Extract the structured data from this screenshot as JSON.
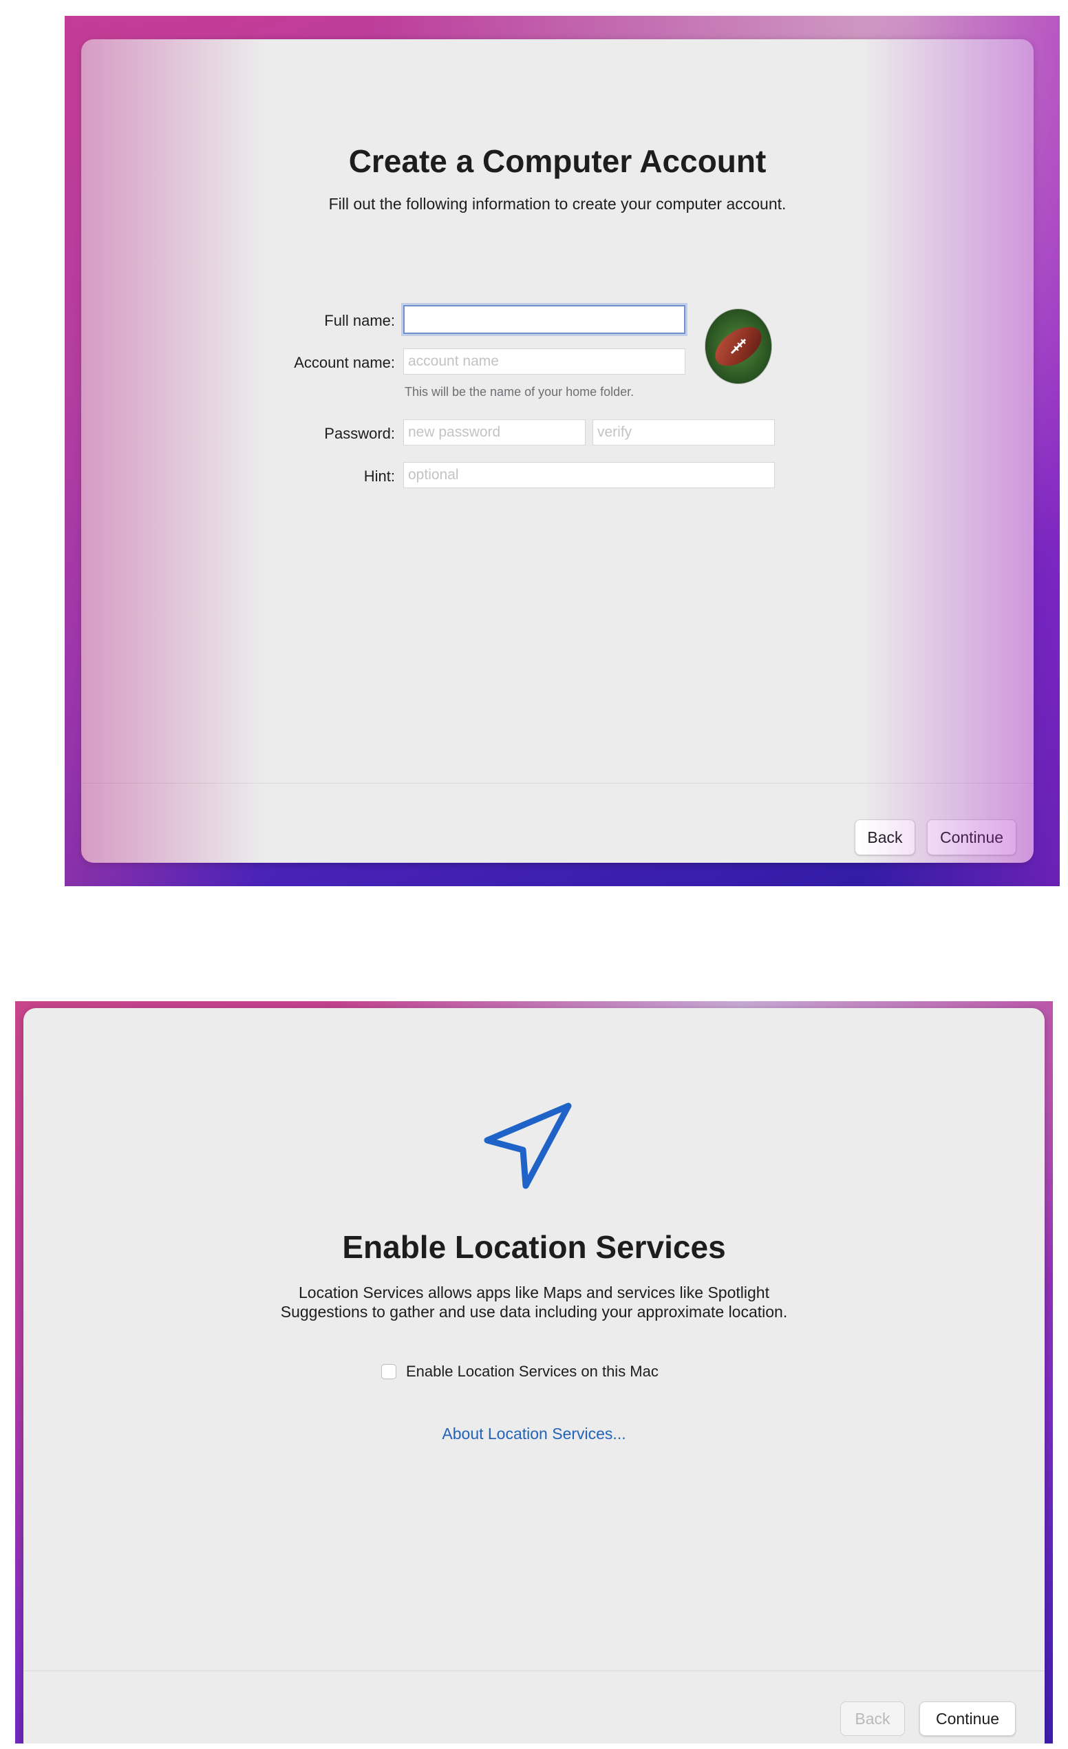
{
  "account_screen": {
    "title": "Create a Computer Account",
    "subtitle": "Fill out the following information to create your computer account.",
    "full_name": {
      "label": "Full name:",
      "value": ""
    },
    "account_name": {
      "label": "Account name:",
      "placeholder": "account name",
      "helper": "This will be the name of your home folder."
    },
    "password": {
      "label": "Password:",
      "placeholder": "new password",
      "verify_placeholder": "verify"
    },
    "hint": {
      "label": "Hint:",
      "placeholder": "optional"
    },
    "avatar_icon": "football-avatar-icon",
    "buttons": {
      "back": "Back",
      "continue": "Continue"
    }
  },
  "location_screen": {
    "icon": "location-arrow-icon",
    "title": "Enable Location Services",
    "description_line1": "Location Services allows apps like Maps and services like Spotlight",
    "description_line2": "Suggestions to gather and use data including your approximate location.",
    "checkbox_label": "Enable Location Services on this Mac",
    "checkbox_checked": false,
    "about_link": "About Location Services...",
    "buttons": {
      "back": "Back",
      "continue": "Continue"
    }
  },
  "colors": {
    "accent_link": "#2363b8",
    "location_icon": "#1f63c8",
    "focus_ring": "#6f8fd3"
  }
}
